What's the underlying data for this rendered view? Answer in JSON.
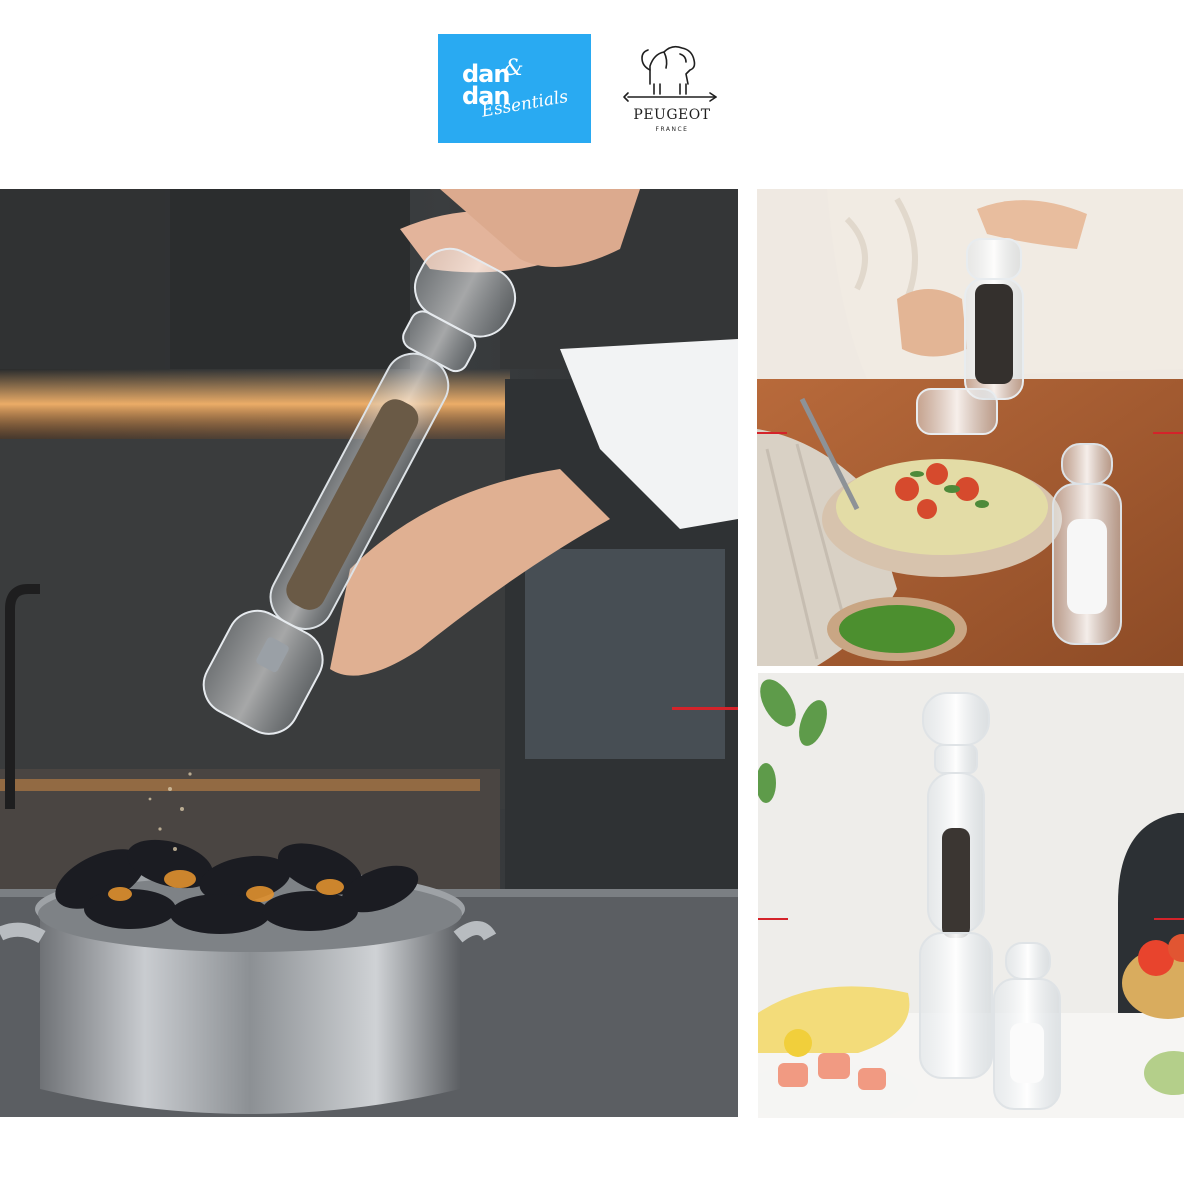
{
  "header": {
    "brand_left": {
      "line1": "dan",
      "ampersand": "&",
      "line2": "dan",
      "line3": "Essentials",
      "bg_color": "#29aaf2"
    },
    "brand_right": {
      "name": "PEUGEOT",
      "country": "FRANCE",
      "emblem": "lion-emblem"
    }
  },
  "gallery": {
    "main_photo": "chef-pepper-mill-over-mussels-pot",
    "top_right_photo": "pepper-mill-over-risotto",
    "bottom_right_photo": "pepper-and-salt-mills-table",
    "accent_color": "#d4232a"
  }
}
